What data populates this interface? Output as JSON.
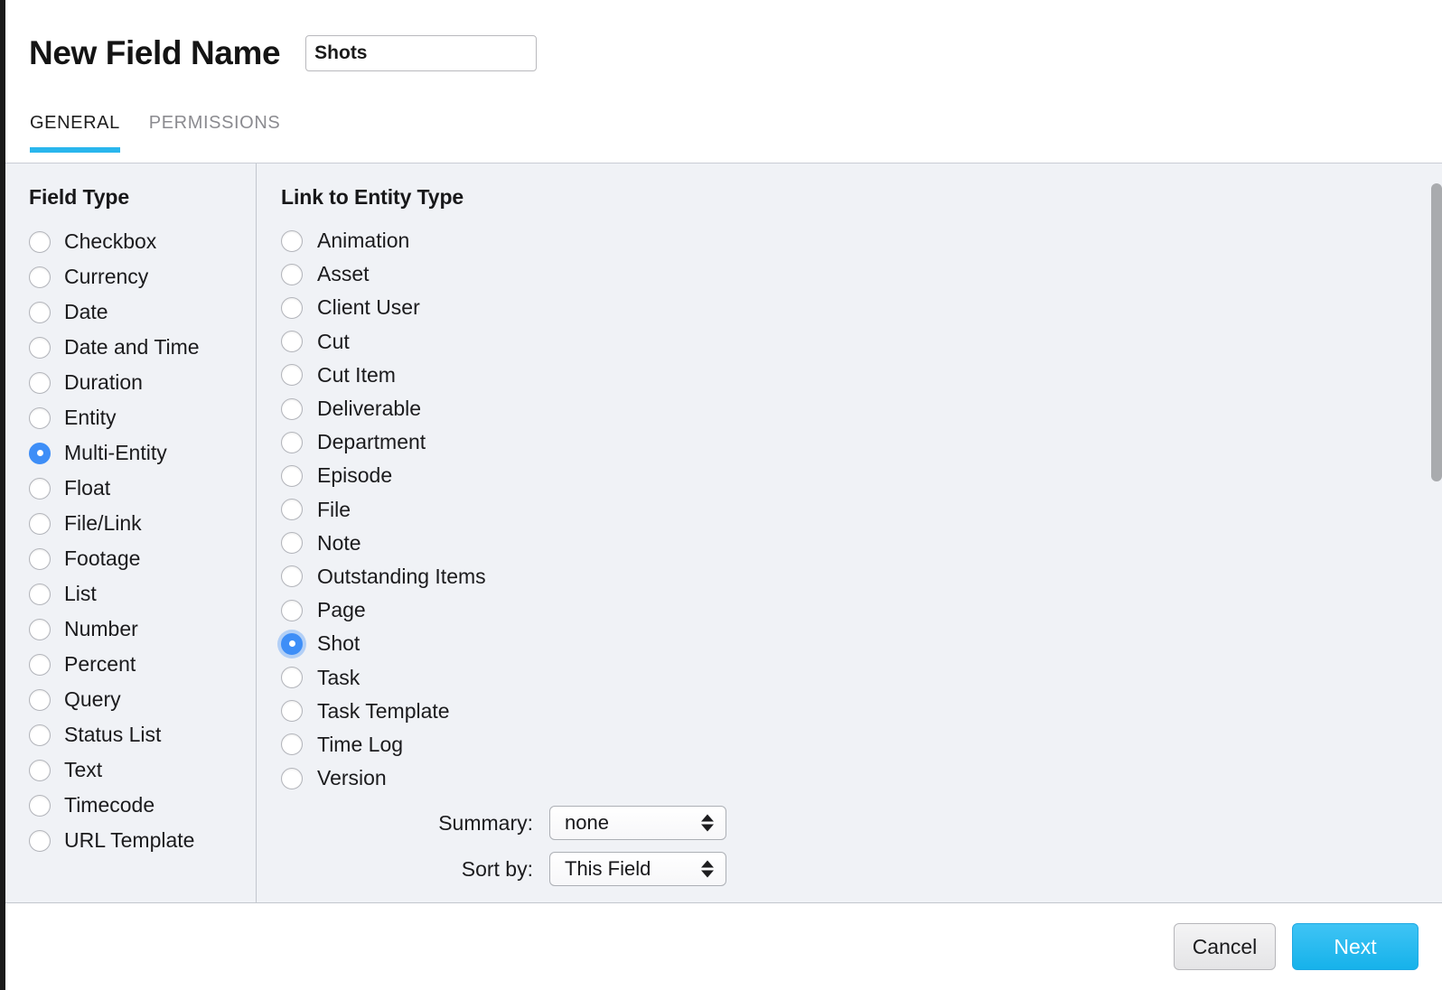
{
  "header": {
    "title": "New Field Name",
    "field_name_value": "Shots",
    "field_name_placeholder": "Field name"
  },
  "tabs": [
    {
      "label": "GENERAL",
      "active": true
    },
    {
      "label": "PERMISSIONS",
      "active": false
    }
  ],
  "field_type": {
    "heading": "Field Type",
    "selected": "Multi-Entity",
    "options": [
      "Checkbox",
      "Currency",
      "Date",
      "Date and Time",
      "Duration",
      "Entity",
      "Multi-Entity",
      "Float",
      "File/Link",
      "Footage",
      "List",
      "Number",
      "Percent",
      "Query",
      "Status List",
      "Text",
      "Timecode",
      "URL Template"
    ]
  },
  "link_entity": {
    "heading": "Link to Entity Type",
    "selected": "Shot",
    "options": [
      "Animation",
      "Asset",
      "Client User",
      "Cut",
      "Cut Item",
      "Deliverable",
      "Department",
      "Episode",
      "File",
      "Note",
      "Outstanding Items",
      "Page",
      "Shot",
      "Task",
      "Task Template",
      "Time Log",
      "Version"
    ]
  },
  "settings": [
    {
      "label": "Summary:",
      "value": "none"
    },
    {
      "label": "Sort by:",
      "value": "This Field"
    }
  ],
  "footer": {
    "cancel_label": "Cancel",
    "next_label": "Next"
  },
  "colors": {
    "accent": "#29b6ed",
    "radio_selected": "#3e8ef7",
    "panel_background": "#f0f2f6",
    "primary_button": "#16b2ea"
  }
}
